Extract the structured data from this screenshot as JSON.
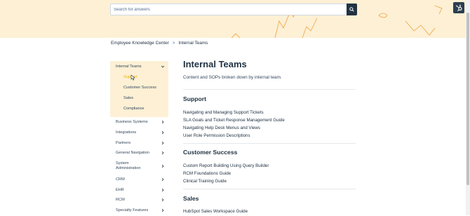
{
  "search": {
    "placeholder": "Search for answers"
  },
  "breadcrumb": {
    "parent": "Employee Knowledge Center",
    "separator": ">",
    "current": "Internal Teams"
  },
  "sidebar": {
    "expanded": {
      "label": "Internal Teams",
      "children": [
        "Support",
        "Customer Success",
        "Sales",
        "Compliance"
      ]
    },
    "items": [
      "Business Systems",
      "Integrations",
      "Partners",
      "General Navigation",
      "System Administration",
      "CRM",
      "EHR",
      "RCM",
      "Specialty Features"
    ]
  },
  "page": {
    "title": "Internal Teams",
    "description": "Content and SOPs broken down by internal team."
  },
  "sections": [
    {
      "title": "Support",
      "links": [
        "Navigating and Managing Support Tickets",
        "SLA Goals and Ticket Response Management Guide",
        "Navigating Help Desk Menus and Views",
        "User Role Permission Descriptions"
      ]
    },
    {
      "title": "Customer Success",
      "links": [
        "Custom Report Building Using Query Builder",
        "RCM Foundations Guide",
        "Clinical Training Guide"
      ]
    },
    {
      "title": "Sales",
      "links": [
        "HubSpot Sales Workspace Guide"
      ]
    }
  ],
  "colors": {
    "hero": "#fdf0d5",
    "sidebar_active": "#e5b100",
    "dark": "#213343"
  },
  "icons": {
    "search": "search-icon",
    "logo": "hubspot-logo-icon",
    "chevron": "chevron-right-icon",
    "expand": "chevron-down-icon"
  }
}
